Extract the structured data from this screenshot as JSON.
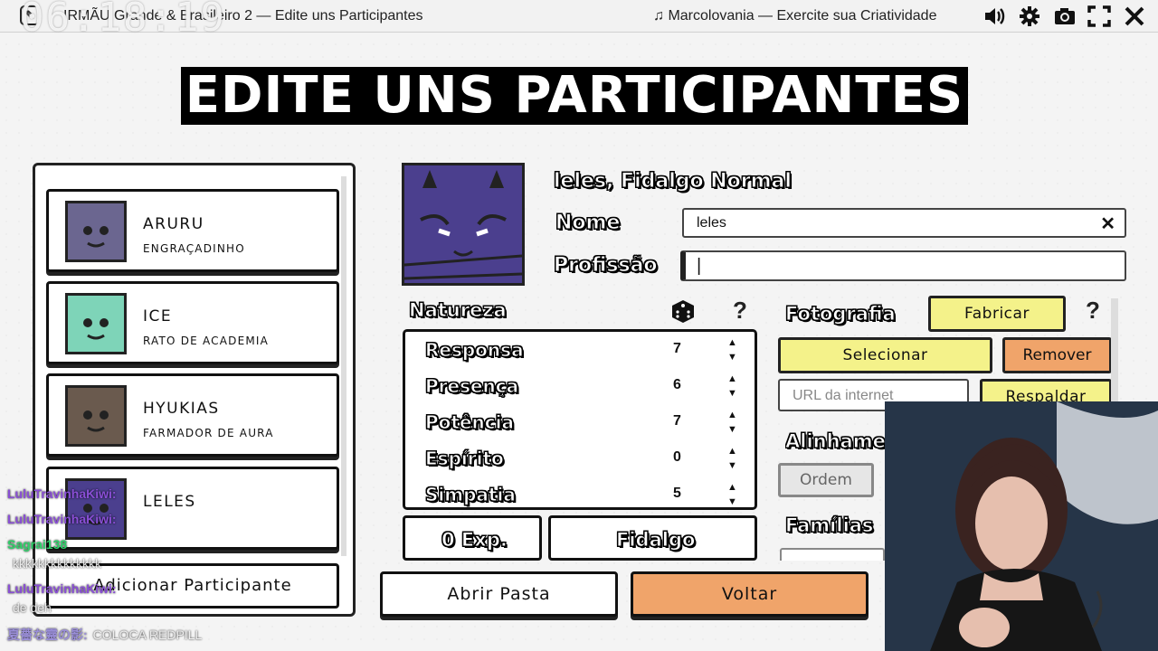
{
  "window": {
    "title": "IRMÃU Grande & Brasileiro 2 — Edite uns Participantes",
    "clock": "06:18:19",
    "music": "♫ Marcolovania — Exercite sua Criatividade",
    "controls": {
      "volume": "volume-icon",
      "settings": "gear-icon",
      "screenshot": "camera-icon",
      "fullscreen": "fullscreen-icon",
      "close": "close-icon"
    }
  },
  "page": {
    "title": "EDITE UNS PARTICIPANTES"
  },
  "participants": [
    {
      "name": "ARURU",
      "job": "ENGRAÇADINHO",
      "color": "#6b6690"
    },
    {
      "name": "ICE",
      "job": "RATO DE ACADEMIA",
      "color": "#7ed4b8"
    },
    {
      "name": "HYUKIAS",
      "job": "FARMADOR DE AURA",
      "color": "#6a5a4e"
    },
    {
      "name": "LELES",
      "job": "",
      "color": "#4b3f8e"
    }
  ],
  "add_participant_label": "Adicionar Participante",
  "editor": {
    "heading": "leles, Fidalgo Normal",
    "name_label": "Nome",
    "name_value": "leles",
    "profession_label": "Profissão",
    "profession_value": "",
    "nature_label": "Natureza",
    "stats": [
      {
        "name": "Responsa",
        "value": 7
      },
      {
        "name": "Presença",
        "value": 6
      },
      {
        "name": "Potência",
        "value": 7
      },
      {
        "name": "Espírito",
        "value": 0
      },
      {
        "name": "Simpatia",
        "value": 5
      }
    ],
    "exp_label": "0 Exp.",
    "class_label": "Fidalgo",
    "photo_label": "Fotografia",
    "fabricate_label": "Fabricar",
    "select_label": "Selecionar",
    "remove_label": "Remover",
    "url_placeholder": "URL da internet",
    "backup_label": "Respaldar",
    "alignment_label": "Alinhamento",
    "order_label": "Ordem",
    "families_label": "Famílias"
  },
  "bottom": {
    "open_folder": "Abrir Pasta",
    "back": "Voltar"
  },
  "chat": [
    {
      "user": "LuluTravinhaKiwi:",
      "msg": "",
      "color": "#8a4fd6"
    },
    {
      "user": "LuluTravinhaKiwi:",
      "msg": "",
      "color": "#8a4fd6"
    },
    {
      "user": "Sagrai138",
      "msg": "",
      "color": "#2fd16a"
    },
    {
      "user": "",
      "msg": "kkkkkkkkkkkkkk",
      "color": "#ffffff"
    },
    {
      "user": "LuluTravinhaKiwi:",
      "msg": "",
      "color": "#8a4fd6"
    },
    {
      "user": "",
      "msg": "de deh",
      "color": "#ffffff"
    },
    {
      "user": "夏薔な靈の影:",
      "msg": "COLOCA REDPILL",
      "color": "#9b8fd9"
    }
  ]
}
